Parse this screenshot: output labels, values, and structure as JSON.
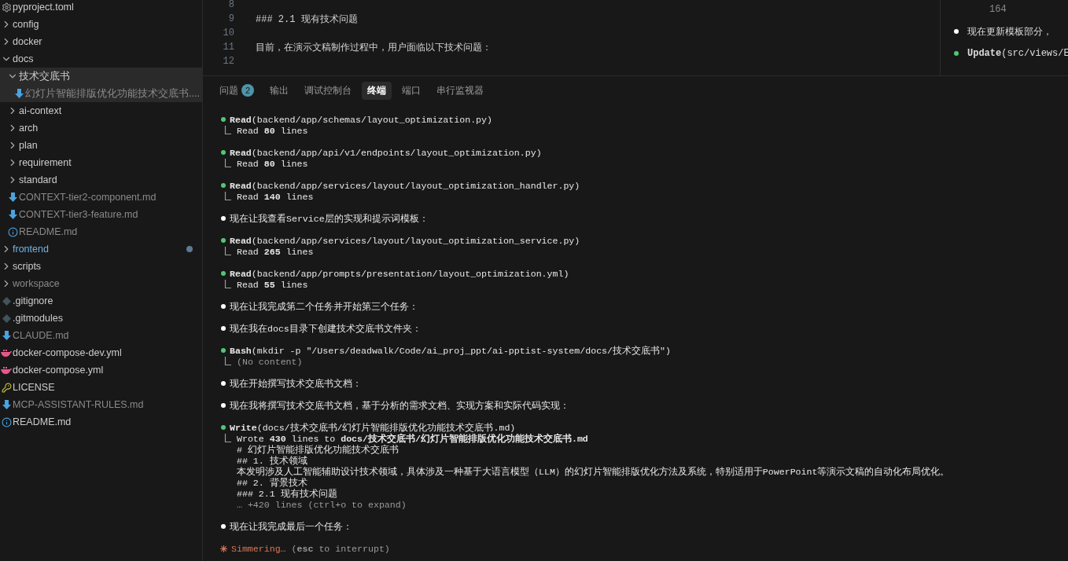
{
  "sidebar": {
    "items": [
      {
        "kind": "settings",
        "label": "pyproject.toml",
        "selected": false,
        "ignored": false,
        "modified": false
      },
      {
        "kind": "folder",
        "label": "config",
        "expanded": false,
        "selected": false,
        "ignored": false,
        "modified": false
      },
      {
        "kind": "folder",
        "label": "docker",
        "expanded": false,
        "selected": false,
        "ignored": false,
        "modified": false
      },
      {
        "kind": "folder",
        "label": "docs",
        "expanded": true,
        "selected": false,
        "ignored": false,
        "modified": false,
        "children": [
          {
            "kind": "folder",
            "label": "技术交底书",
            "expanded": true,
            "selected": true,
            "ignored": false,
            "modified": false,
            "children": [
              {
                "kind": "markdown",
                "label": "幻灯片智能排版优化功能技术交底书....",
                "selected": true,
                "ignored": true,
                "modified": false
              }
            ]
          },
          {
            "kind": "folder",
            "label": "ai-context",
            "expanded": false,
            "selected": false,
            "ignored": false,
            "modified": false
          },
          {
            "kind": "folder",
            "label": "arch",
            "expanded": false,
            "selected": false,
            "ignored": false,
            "modified": false
          },
          {
            "kind": "folder",
            "label": "plan",
            "expanded": false,
            "selected": false,
            "ignored": false,
            "modified": false
          },
          {
            "kind": "folder",
            "label": "requirement",
            "expanded": false,
            "selected": false,
            "ignored": false,
            "modified": false
          },
          {
            "kind": "folder",
            "label": "standard",
            "expanded": false,
            "selected": false,
            "ignored": false,
            "modified": false
          },
          {
            "kind": "markdown",
            "label": "CONTEXT-tier2-component.md",
            "selected": false,
            "ignored": true,
            "modified": false
          },
          {
            "kind": "markdown",
            "label": "CONTEXT-tier3-feature.md",
            "selected": false,
            "ignored": true,
            "modified": false
          },
          {
            "kind": "info",
            "label": "README.md",
            "selected": false,
            "ignored": true,
            "modified": false
          }
        ]
      },
      {
        "kind": "folder",
        "label": "frontend",
        "expanded": false,
        "selected": false,
        "ignored": false,
        "modified": true
      },
      {
        "kind": "folder",
        "label": "scripts",
        "expanded": false,
        "selected": false,
        "ignored": false,
        "modified": false
      },
      {
        "kind": "folder",
        "label": "workspace",
        "expanded": false,
        "selected": false,
        "ignored": true,
        "modified": false
      },
      {
        "kind": "git",
        "label": ".gitignore",
        "selected": false,
        "ignored": false,
        "modified": false
      },
      {
        "kind": "git",
        "label": ".gitmodules",
        "selected": false,
        "ignored": false,
        "modified": false
      },
      {
        "kind": "markdown",
        "label": "CLAUDE.md",
        "selected": false,
        "ignored": true,
        "modified": false
      },
      {
        "kind": "docker",
        "label": "docker-compose-dev.yml",
        "selected": false,
        "ignored": false,
        "modified": false
      },
      {
        "kind": "docker",
        "label": "docker-compose.yml",
        "selected": false,
        "ignored": false,
        "modified": false
      },
      {
        "kind": "license",
        "label": "LICENSE",
        "selected": false,
        "ignored": false,
        "modified": false
      },
      {
        "kind": "markdown",
        "label": "MCP-ASSISTANT-RULES.md",
        "selected": false,
        "ignored": true,
        "modified": false
      },
      {
        "kind": "info",
        "label": "README.md",
        "selected": false,
        "ignored": false,
        "modified": false
      }
    ]
  },
  "editor": {
    "lines": [
      {
        "number": "8"
      },
      {
        "number": "9",
        "kind": "code",
        "text": "### 2.1 现有技术问题"
      },
      {
        "number": "10"
      },
      {
        "number": "11",
        "kind": "prose",
        "text": "目前，在演示文稿制作过程中，用户面临以下技术问题："
      },
      {
        "number": "12"
      }
    ]
  },
  "side_panel": {
    "lines": [
      {
        "kind": "number",
        "text": "164"
      },
      {
        "kind": "message",
        "text": "现在更新模板部分，"
      },
      {
        "kind": "tool",
        "text": "**Update**(src/views/E"
      }
    ]
  },
  "panel": {
    "tabs": [
      {
        "label": "问题",
        "badge": "2",
        "selected": false
      },
      {
        "label": "输出",
        "selected": false
      },
      {
        "label": "调试控制台",
        "selected": false
      },
      {
        "label": "终端",
        "selected": true
      },
      {
        "label": "端口",
        "selected": false
      },
      {
        "label": "串行监视器",
        "selected": false
      }
    ]
  },
  "terminal": {
    "entries": [
      {
        "kind": "tool",
        "text": "**Read**(backend/app/schemas/layout_optimization.py)",
        "result": [
          {
            "text": "Read **80** lines",
            "muted": false
          }
        ]
      },
      {
        "kind": "tool",
        "text": "**Read**(backend/app/api/v1/endpoints/layout_optimization.py)",
        "result": [
          {
            "text": "Read **80** lines",
            "muted": false
          }
        ]
      },
      {
        "kind": "tool",
        "text": "**Read**(backend/app/services/layout/layout_optimization_handler.py)",
        "result": [
          {
            "text": "Read **140** lines",
            "muted": false
          }
        ]
      },
      {
        "kind": "message",
        "text": "现在让我查看Service层的实现和提示词模板："
      },
      {
        "kind": "tool",
        "text": "**Read**(backend/app/services/layout/layout_optimization_service.py)",
        "result": [
          {
            "text": "Read **265** lines",
            "muted": false
          }
        ]
      },
      {
        "kind": "tool",
        "text": "**Read**(backend/app/prompts/presentation/layout_optimization.yml)",
        "result": [
          {
            "text": "Read **55** lines",
            "muted": false
          }
        ]
      },
      {
        "kind": "message",
        "text": "现在让我完成第二个任务并开始第三个任务："
      },
      {
        "kind": "message",
        "text": "现在我在docs目录下创建技术交底书文件夹："
      },
      {
        "kind": "tool",
        "text": "**Bash**(mkdir -p \"/Users/deadwalk/Code/ai_proj_ppt/ai-pptist-system/docs/技术交底书\")",
        "result": [
          {
            "text": "(No content)",
            "muted": true
          }
        ]
      },
      {
        "kind": "message",
        "text": "现在开始撰写技术交底书文档："
      },
      {
        "kind": "message",
        "text": "现在我将撰写技术交底书文档，基于分析的需求文档、实现方案和实际代码实现："
      },
      {
        "kind": "tool",
        "text": "**Write**(docs/技术交底书/幻灯片智能排版优化功能技术交底书.md)",
        "result": [
          {
            "text": "Wrote **430** lines to **docs/技术交底书/幻灯片智能排版优化功能技术交底书.md**",
            "muted": false
          },
          {
            "text": "# 幻灯片智能排版优化功能技术交底书",
            "muted": false
          },
          {
            "text": "## 1. 技术领域",
            "muted": false
          },
          {
            "text": "本发明涉及人工智能辅助设计技术领域，具体涉及一种基于大语言模型（LLM）的幻灯片智能排版优化方法及系统，特别适用于PowerPoint等演示文稿的自动化布局优化。",
            "muted": false
          },
          {
            "text": "## 2. 背景技术",
            "muted": false
          },
          {
            "text": "### 2.1 现有技术问题",
            "muted": false
          },
          {
            "text": "… +420 lines (ctrl+o to expand)",
            "muted": true
          }
        ]
      },
      {
        "kind": "message",
        "text": "现在让我完成最后一个任务："
      },
      {
        "kind": "status",
        "label": "Simmering…",
        "hint": "(**esc** to interrupt)"
      }
    ]
  }
}
